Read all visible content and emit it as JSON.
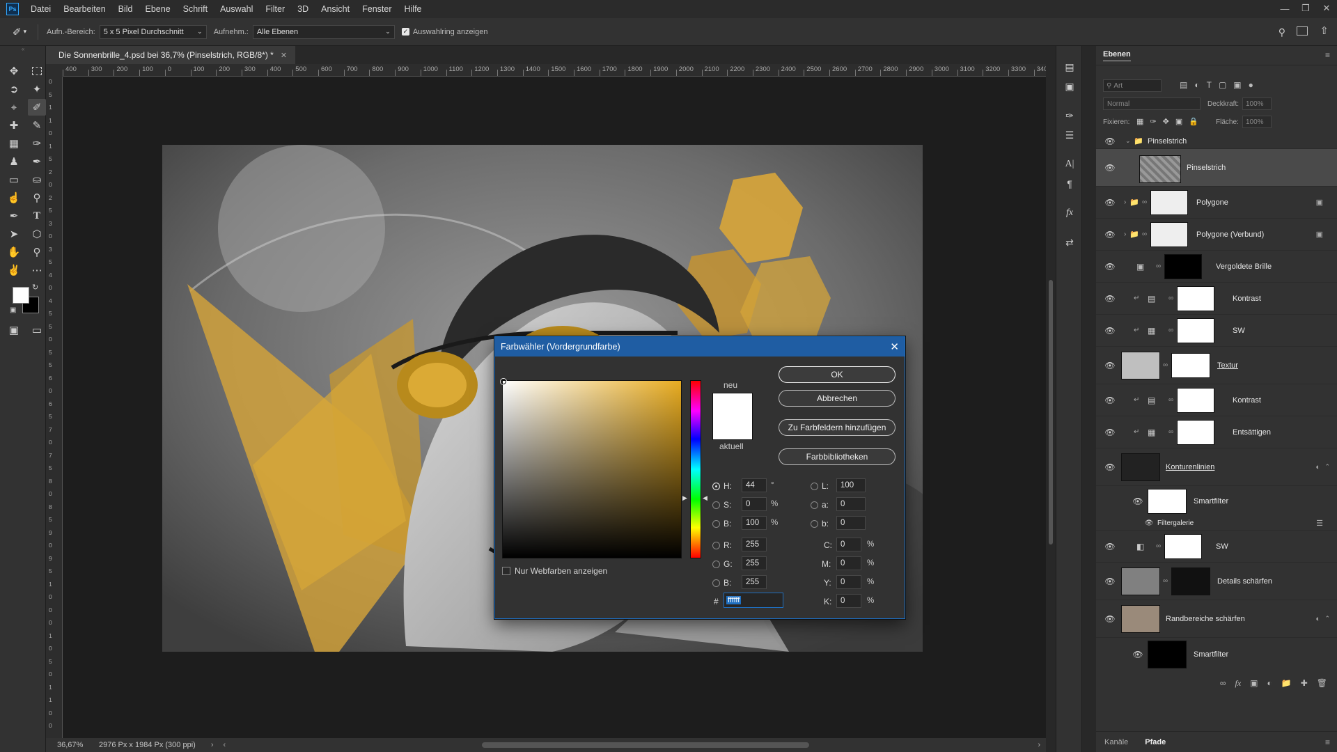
{
  "menubar": {
    "logo": "Ps",
    "items": [
      "Datei",
      "Bearbeiten",
      "Bild",
      "Ebene",
      "Schrift",
      "Auswahl",
      "Filter",
      "3D",
      "Ansicht",
      "Fenster",
      "Hilfe"
    ]
  },
  "options": {
    "sample_label": "Aufn.-Bereich:",
    "sample_value": "5 x 5 Pixel Durchschnitt",
    "layers_label": "Aufnehm.:",
    "layers_value": "Alle Ebenen",
    "ring_label": "Auswahlring anzeigen",
    "ring_checked": true
  },
  "document": {
    "tab_title": "Die Sonnenbrille_4.psd bei 36,7% (Pinselstrich, RGB/8*) *",
    "ruler_top": [
      "400",
      "300",
      "200",
      "100",
      "0",
      "100",
      "200",
      "300",
      "400",
      "500",
      "600",
      "700",
      "800",
      "900",
      "1000",
      "1100",
      "1200",
      "1300",
      "1400",
      "1500",
      "1600",
      "1700",
      "1800",
      "1900",
      "2000",
      "2100",
      "2200",
      "2300",
      "2400",
      "2500",
      "2600",
      "2700",
      "2800",
      "2900",
      "3000",
      "3100",
      "3200",
      "3300",
      "3400"
    ],
    "ruler_left": [
      "0",
      "5",
      "1",
      "1",
      "0",
      "1",
      "5",
      "2",
      "0",
      "2",
      "5",
      "3",
      "0",
      "3",
      "5",
      "4",
      "0",
      "4",
      "5",
      "5",
      "0",
      "5",
      "5",
      "6",
      "0",
      "6",
      "5",
      "7",
      "0",
      "7",
      "5",
      "8",
      "0",
      "8",
      "5",
      "9",
      "0",
      "9",
      "5",
      "1",
      "0",
      "0",
      "0",
      "1",
      "0",
      "5",
      "0",
      "1",
      "1",
      "0",
      "0"
    ],
    "zoom": "36,67%",
    "doc_info": "2976 Px x 1984 Px (300 ppi)"
  },
  "dialog": {
    "title": "Farbwähler (Vordergrundfarbe)",
    "new_label": "neu",
    "current_label": "aktuell",
    "buttons": {
      "ok": "OK",
      "cancel": "Abbrechen",
      "add_swatch": "Zu Farbfeldern hinzufügen",
      "libraries": "Farbbibliotheken"
    },
    "web_only_label": "Nur Webfarben anzeigen",
    "fields": {
      "H": {
        "label": "H:",
        "value": "44",
        "unit": "°"
      },
      "S": {
        "label": "S:",
        "value": "0",
        "unit": "%"
      },
      "Bv": {
        "label": "B:",
        "value": "100",
        "unit": "%"
      },
      "R": {
        "label": "R:",
        "value": "255"
      },
      "G": {
        "label": "G:",
        "value": "255"
      },
      "Bc": {
        "label": "B:",
        "value": "255"
      },
      "L": {
        "label": "L:",
        "value": "100"
      },
      "a": {
        "label": "a:",
        "value": "0"
      },
      "b": {
        "label": "b:",
        "value": "0"
      },
      "C": {
        "label": "C:",
        "value": "0",
        "unit": "%"
      },
      "M": {
        "label": "M:",
        "value": "0",
        "unit": "%"
      },
      "Y": {
        "label": "Y:",
        "value": "0",
        "unit": "%"
      },
      "K": {
        "label": "K:",
        "value": "0",
        "unit": "%"
      }
    },
    "hash": "#",
    "hex": "ffffff",
    "new_color": "#ffffff",
    "current_color": "#ffffff",
    "field_hue_color": "#e8ac21"
  },
  "panel": {
    "tab": "Ebenen",
    "filter_placeholder": "Art",
    "blend": "Normal",
    "opacity_label": "Deckkraft:",
    "opacity": "100%",
    "lock_label": "Fixieren:",
    "fill_label": "Fläche:",
    "fill": "100%",
    "layers": [
      {
        "name": "Pinselstrich"
      },
      {
        "name": "Pinselstrich"
      },
      {
        "name": "Polygone"
      },
      {
        "name": "Polygone (Verbund)"
      },
      {
        "name": "Vergoldete Brille"
      },
      {
        "name": "Kontrast"
      },
      {
        "name": "SW"
      },
      {
        "name": "Textur"
      },
      {
        "name": "Kontrast"
      },
      {
        "name": "Entsättigen"
      },
      {
        "name": "Konturenlinien"
      },
      {
        "name": "Smartfilter"
      },
      {
        "name": "Filtergalerie"
      },
      {
        "name": "SW"
      },
      {
        "name": "Details schärfen"
      },
      {
        "name": "Randbereiche schärfen"
      },
      {
        "name": "Smartfilter"
      }
    ],
    "bottom_tabs": [
      "Kanäle",
      "Pfade"
    ]
  },
  "colors": {
    "accent": "#1f5da3",
    "gold": "#e8ac21",
    "foreground": "#ffffff",
    "background": "#000000"
  }
}
